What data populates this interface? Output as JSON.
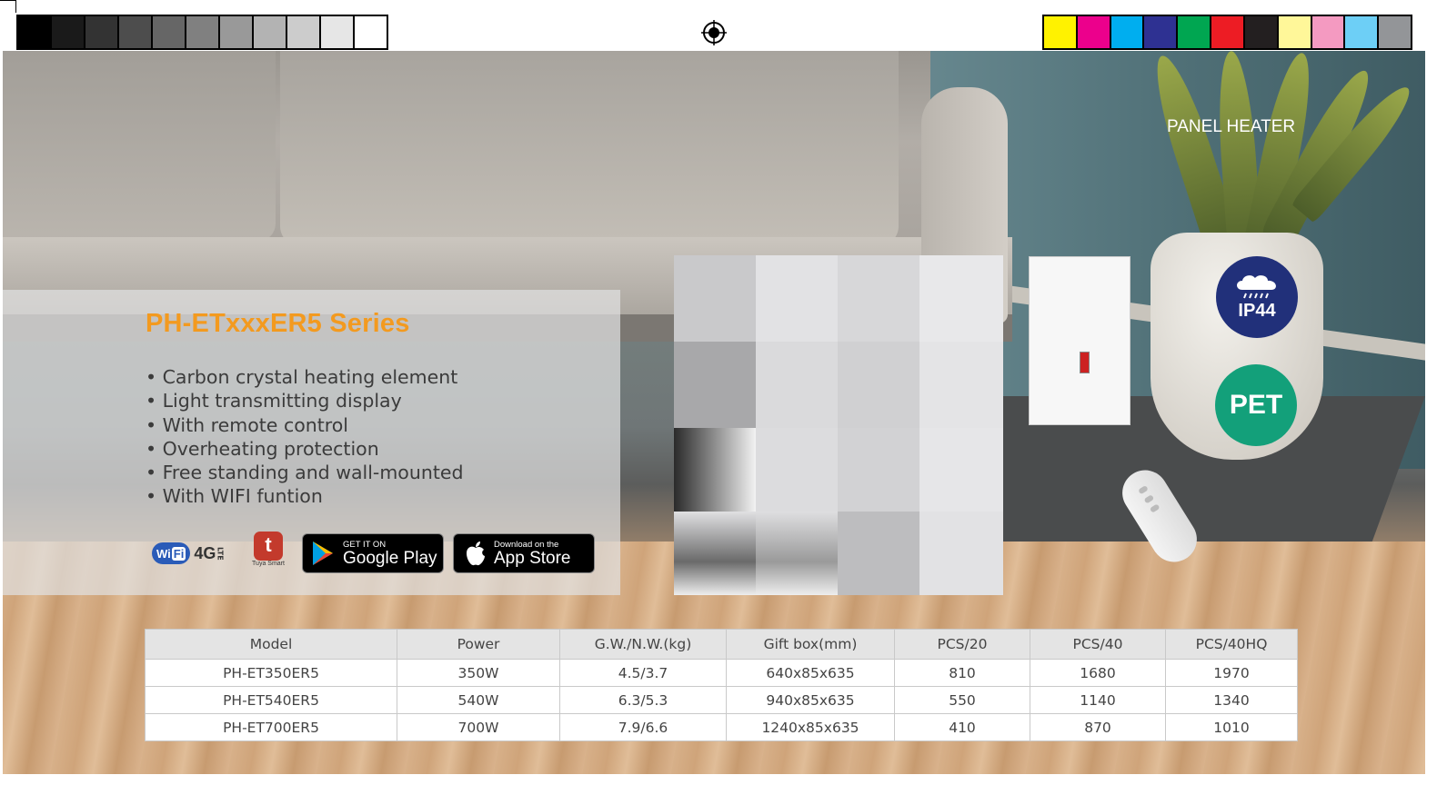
{
  "print_marks": {
    "gray_swatches": [
      "#000000",
      "#1a1a1a",
      "#333333",
      "#4d4d4d",
      "#666666",
      "#808080",
      "#999999",
      "#b3b3b3",
      "#cccccc",
      "#e6e6e6",
      "#ffffff"
    ],
    "color_swatches": [
      "#fff200",
      "#ec008c",
      "#00aeef",
      "#2e3192",
      "#00a651",
      "#ed1c24",
      "#231f20",
      "#fff799",
      "#f49ac1",
      "#6dcff6",
      "#939598"
    ]
  },
  "header": {
    "category": "PANEL HEATER"
  },
  "product": {
    "series_title": "PH-ETxxxER5 Series",
    "title_color": "#f39a1f",
    "features": [
      "Carbon crystal heating element",
      "Light transmitting display",
      "With remote control",
      "Overheating protection",
      "Free standing and wall-mounted",
      "With WIFI funtion"
    ]
  },
  "badges": {
    "ip_rating": "IP44",
    "ip_color": "#21307a",
    "material": "PET",
    "material_color": "#13a07a"
  },
  "connectivity": {
    "wifi_label": "Wi",
    "wifi_label2": "Fi",
    "network_label": "4G",
    "network_sub": "LTE",
    "tuya_letter": "t",
    "tuya_label": "Tuya Smart",
    "google_play": {
      "small": "GET IT ON",
      "big": "Google Play"
    },
    "app_store": {
      "small": "Download on the",
      "big": "App Store"
    }
  },
  "spec_table": {
    "headers": [
      "Model",
      "Power",
      "G.W./N.W.(kg)",
      "Gift box(mm)",
      "PCS/20",
      "PCS/40",
      "PCS/40HQ"
    ],
    "rows": [
      [
        "PH-ET350ER5",
        "350W",
        "4.5/3.7",
        "640x85x635",
        "810",
        "1680",
        "1970"
      ],
      [
        "PH-ET540ER5",
        "540W",
        "6.3/5.3",
        "940x85x635",
        "550",
        "1140",
        "1340"
      ],
      [
        "PH-ET700ER5",
        "700W",
        "7.9/6.6",
        "1240x85x635",
        "410",
        "870",
        "1010"
      ]
    ]
  }
}
